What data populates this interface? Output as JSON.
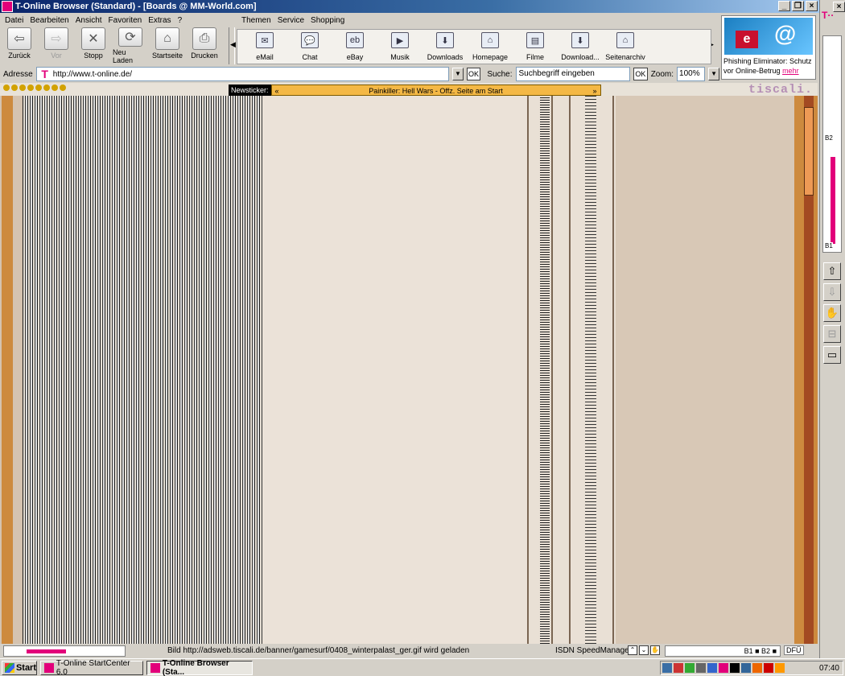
{
  "window": {
    "title": "T-Online Browser (Standard) - [Boards @ MM-World.com]",
    "controls": [
      "_",
      "❐",
      "×"
    ]
  },
  "menu": {
    "main": [
      "Datei",
      "Bearbeiten",
      "Ansicht",
      "Favoriten",
      "Extras",
      "?"
    ],
    "secondary": [
      "Themen",
      "Service",
      "Shopping"
    ]
  },
  "nav_toolbar": {
    "back": "Zurück",
    "forward": "Vor",
    "stop": "Stopp",
    "reload": "Neu Laden",
    "home": "Startseite",
    "print": "Drucken"
  },
  "service_toolbar": [
    {
      "label": "eMail",
      "icon": "envelope-icon",
      "glyph": "✉"
    },
    {
      "label": "Chat",
      "icon": "chat-icon",
      "glyph": "💬"
    },
    {
      "label": "eBay",
      "icon": "ebay-icon",
      "glyph": "eb"
    },
    {
      "label": "Musik",
      "icon": "play-icon",
      "glyph": "▶"
    },
    {
      "label": "Downloads",
      "icon": "download-icon",
      "glyph": "⬇"
    },
    {
      "label": "Homepage",
      "icon": "homepage-icon",
      "glyph": "⌂"
    },
    {
      "label": "Filme",
      "icon": "film-icon",
      "glyph": "▤"
    },
    {
      "label": "Download...",
      "icon": "download-manager-icon",
      "glyph": "⬇"
    },
    {
      "label": "Seitenarchiv",
      "icon": "archive-icon",
      "glyph": "⌂"
    }
  ],
  "ad": {
    "text": "Phishing Eliminator: Schutz vor Online-Betrug",
    "link": "mehr"
  },
  "address_bar": {
    "label": "Adresse",
    "url": "http://www.t-online.de/",
    "ok": "OK",
    "search_label": "Suche:",
    "search_placeholder": "Suchbegriff eingeben",
    "search_ok": "OK",
    "zoom_label": "Zoom:",
    "zoom_value": "100%"
  },
  "content": {
    "brand": "tiscali.",
    "newsticker_label": "Newsticker:",
    "newsticker_text": "Painkiller: Hell Wars - Offz. Seite am Start",
    "ticker_prev": "«",
    "ticker_next": "»"
  },
  "sidebar": {
    "meter_top_label": "B2",
    "meter_bottom_label": "B1",
    "close": "×"
  },
  "status": {
    "message": "Bild http://adsweb.tiscali.de/banner/gamesurf/0408_winterpalast_ger.gif wird geladen",
    "isdn": "ISDN SpeedManager",
    "channels": "B1 ■ B2 ■",
    "dfue": "DFÜ",
    "progress": 0.49
  },
  "taskbar": {
    "start": "Start",
    "tasks": [
      "T-Online StartCenter 6.0",
      "T-Online Browser (Sta..."
    ],
    "clock": "07:40"
  },
  "colors": {
    "telekom_magenta": "#e2007a",
    "tiscali_purple": "#b58fb5",
    "ticker_yellow": "#f4b845",
    "stripe_orange": "#cd8a3e"
  }
}
